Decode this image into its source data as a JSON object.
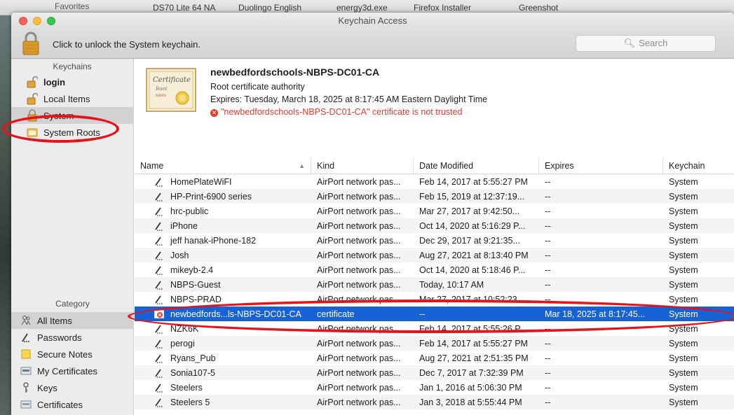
{
  "window": {
    "title": "Keychain Access"
  },
  "desktop": {
    "favorites": "Favorites",
    "bookmarks": [
      "DS70 Lite 64 NA",
      "Duolingo English",
      "energy3d.exe",
      "Firefox Installer",
      "Greenshot"
    ]
  },
  "toolbar": {
    "unlock_text": "Click to unlock the System keychain.",
    "search_placeholder": "Search"
  },
  "sidebar": {
    "keychains_header": "Keychains",
    "keychains": [
      {
        "label": "login",
        "icon": "unlocked-padlock-icon",
        "bold": true
      },
      {
        "label": "Local Items",
        "icon": "unlocked-padlock-icon"
      },
      {
        "label": "System",
        "icon": "padlock-icon",
        "selected": true
      },
      {
        "label": "System Roots",
        "icon": "folder-icon"
      }
    ],
    "category_header": "Category",
    "categories": [
      {
        "label": "All Items",
        "icon": "people-icon",
        "selected": true
      },
      {
        "label": "Passwords",
        "icon": "pencil-icon"
      },
      {
        "label": "Secure Notes",
        "icon": "note-icon"
      },
      {
        "label": "My Certificates",
        "icon": "certificate-icon"
      },
      {
        "label": "Keys",
        "icon": "key-icon"
      },
      {
        "label": "Certificates",
        "icon": "certificate-icon"
      }
    ]
  },
  "certificate": {
    "name": "newbedfordschools-NBPS-DC01-CA",
    "type": "Root certificate authority",
    "expires": "Expires: Tuesday, March 18, 2025 at 8:17:45 AM Eastern Daylight Time",
    "error": "\"newbedfordschools-NBPS-DC01-CA\" certificate is not trusted",
    "badge_lines": [
      "Certificate",
      "Root",
      "NBPS"
    ]
  },
  "table": {
    "columns": [
      "Name",
      "Kind",
      "Date Modified",
      "Expires",
      "Keychain"
    ],
    "rows": [
      {
        "name": "HomePlateWiFI",
        "kind": "AirPort network pas...",
        "date": "Feb 14, 2017 at 5:55:27 PM",
        "expires": "--",
        "keychain": "System"
      },
      {
        "name": "HP-Print-6900 series",
        "kind": "AirPort network pas...",
        "date": "Feb 15, 2019 at 12:37:19...",
        "expires": "--",
        "keychain": "System"
      },
      {
        "name": "hrc-public",
        "kind": "AirPort network pas...",
        "date": "Mar 27, 2017 at 9:42:50...",
        "expires": "--",
        "keychain": "System"
      },
      {
        "name": "iPhone",
        "kind": "AirPort network pas...",
        "date": "Oct 14, 2020 at 5:16:29 P...",
        "expires": "--",
        "keychain": "System"
      },
      {
        "name": "jeff hanak-iPhone-182",
        "kind": "AirPort network pas...",
        "date": "Dec 29, 2017 at 9:21:35...",
        "expires": "--",
        "keychain": "System"
      },
      {
        "name": "Josh",
        "kind": "AirPort network pas...",
        "date": "Aug 27, 2021 at 8:13:40 PM",
        "expires": "--",
        "keychain": "System"
      },
      {
        "name": "mikeyb-2.4",
        "kind": "AirPort network pas...",
        "date": "Oct 14, 2020 at 5:18:46 P...",
        "expires": "--",
        "keychain": "System"
      },
      {
        "name": "NBPS-Guest",
        "kind": "AirPort network pas...",
        "date": "Today, 10:17 AM",
        "expires": "--",
        "keychain": "System"
      },
      {
        "name": "NBPS-PRAD",
        "kind": "AirPort network pas...",
        "date": "Mar 27, 2017 at 10:52:23...",
        "expires": "--",
        "keychain": "System"
      },
      {
        "name": "newbedfords...ls-NBPS-DC01-CA",
        "kind": "certificate",
        "date": "--",
        "expires": "Mar 18, 2025 at 8:17:45...",
        "keychain": "System",
        "selected": true,
        "cert": true
      },
      {
        "name": "NZK6K",
        "kind": "AirPort network pas...",
        "date": "Feb 14, 2017 at 5:55:26 P...",
        "expires": "--",
        "keychain": "System"
      },
      {
        "name": "perogi",
        "kind": "AirPort network pas...",
        "date": "Feb 14, 2017 at 5:55:27 PM",
        "expires": "--",
        "keychain": "System"
      },
      {
        "name": "Ryans_Pub",
        "kind": "AirPort network pas...",
        "date": "Aug 27, 2021 at 2:51:35 PM",
        "expires": "--",
        "keychain": "System"
      },
      {
        "name": "Sonia107-5",
        "kind": "AirPort network pas...",
        "date": "Dec 7, 2017 at 7:32:39 PM",
        "expires": "--",
        "keychain": "System"
      },
      {
        "name": "Steelers",
        "kind": "AirPort network pas...",
        "date": "Jan 1, 2016 at 5:06:30 PM",
        "expires": "--",
        "keychain": "System"
      },
      {
        "name": "Steelers 5",
        "kind": "AirPort network pas...",
        "date": "Jan 3, 2018 at 5:55:44 PM",
        "expires": "--",
        "keychain": "System"
      }
    ]
  },
  "colors": {
    "selection": "#1762d4",
    "annotation": "#e3141b",
    "error": "#e33a2e"
  }
}
